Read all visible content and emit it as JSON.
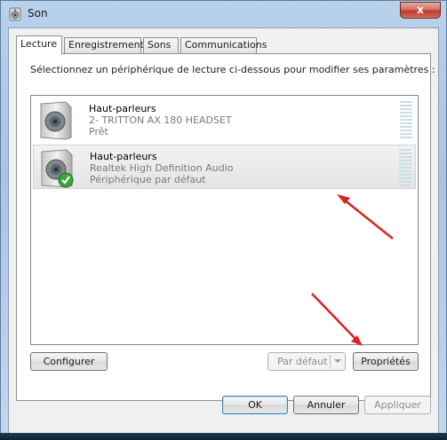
{
  "window": {
    "title": "Son",
    "close_glyph": "x"
  },
  "tabs": [
    {
      "label": "Lecture",
      "active": true
    },
    {
      "label": "Enregistrement",
      "active": false
    },
    {
      "label": "Sons",
      "active": false
    },
    {
      "label": "Communications",
      "active": false
    }
  ],
  "instruction": "Sélectionnez un périphérique de lecture ci-dessous pour modifier ses paramètres :",
  "devices": [
    {
      "name": "Haut-parleurs",
      "description": "2- TRITTON AX 180 HEADSET",
      "status": "Prêt",
      "icon": "speaker-icon",
      "selected": false,
      "default": false
    },
    {
      "name": "Haut-parleurs",
      "description": "Realtek High Definition Audio",
      "status": "Périphérique par défaut",
      "icon": "speaker-icon",
      "selected": true,
      "default": true
    }
  ],
  "buttons": {
    "configure": "Configurer",
    "set_default": "Par défaut",
    "properties": "Propriétés",
    "ok": "OK",
    "cancel": "Annuler",
    "apply": "Appliquer"
  },
  "colors": {
    "annotation_arrow": "#e02020",
    "check_badge": "#3aa63a"
  }
}
